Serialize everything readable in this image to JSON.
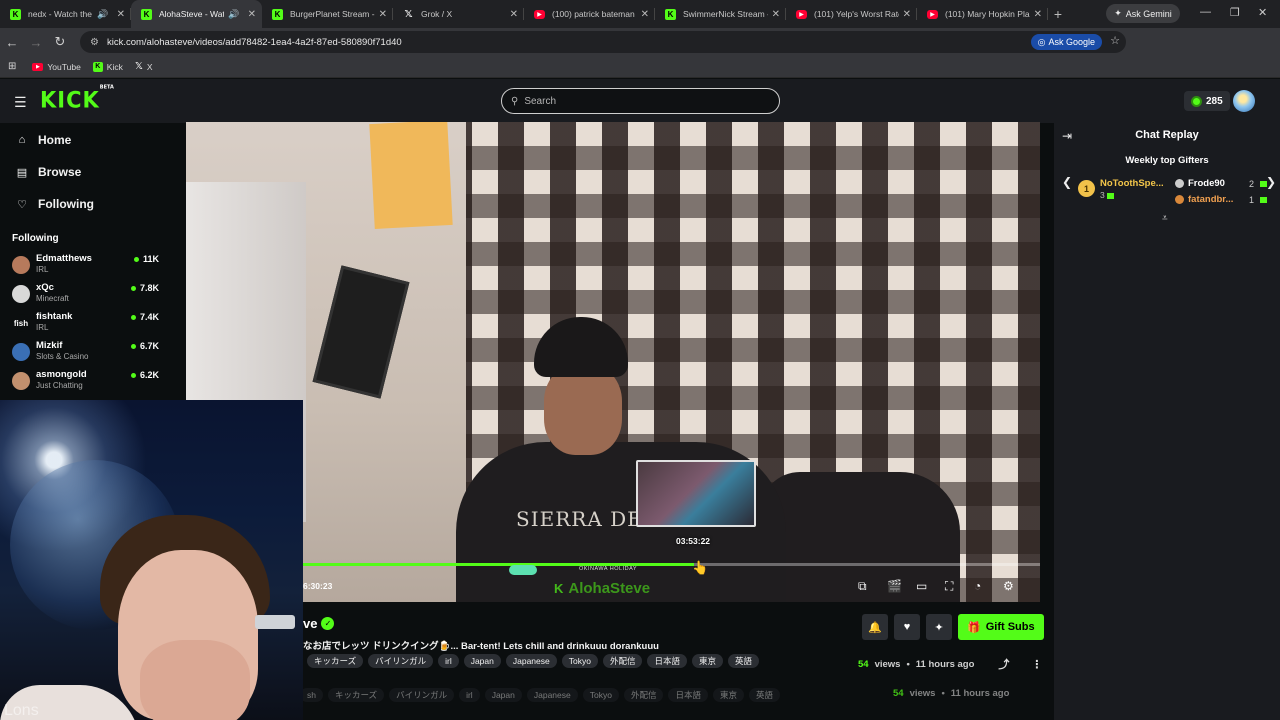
{
  "browser": {
    "tabs": [
      {
        "favicon": "kick",
        "title": "nedx - Watch the V",
        "audio": true
      },
      {
        "favicon": "kick",
        "title": "AlohaSteve - Watch",
        "audio": true,
        "active": true
      },
      {
        "favicon": "kick",
        "title": "BurgerPlanet Stream -"
      },
      {
        "favicon": "x",
        "title": "Grok / X"
      },
      {
        "favicon": "youtube",
        "title": "(100) patrick bateman"
      },
      {
        "favicon": "kick",
        "title": "SwimmerNick Stream -"
      },
      {
        "favicon": "youtube",
        "title": "(101) Yelp's Worst Rate"
      },
      {
        "favicon": "youtube",
        "title": "(101) Mary Hopkin Pla"
      }
    ],
    "ask_gemini": "Ask Gemini",
    "url": "kick.com/alohasteve/videos/add78482-1ea4-4a2f-87ed-580890f71d40",
    "ask_google": "Ask Google",
    "bookmarks": [
      {
        "favicon": "youtube",
        "label": "YouTube"
      },
      {
        "favicon": "kick",
        "label": "Kick"
      },
      {
        "favicon": "x",
        "label": "X"
      }
    ]
  },
  "header": {
    "logo": "KICK",
    "logo_badge": "BETA",
    "search_placeholder": "Search",
    "points": "285"
  },
  "sidebar": {
    "nav": [
      {
        "icon": "home-icon",
        "label": "Home"
      },
      {
        "icon": "browse-icon",
        "label": "Browse"
      },
      {
        "icon": "heart-icon",
        "label": "Following"
      }
    ],
    "following_title": "Following",
    "following": [
      {
        "name": "Edmatthews",
        "category": "IRL",
        "viewers": "11K",
        "color": "#b77a5c"
      },
      {
        "name": "xQc",
        "category": "Minecraft",
        "viewers": "7.8K",
        "color": "#d8d8d8"
      },
      {
        "name": "fishtank",
        "category": "IRL",
        "viewers": "7.4K",
        "color": "#ffffff"
      },
      {
        "name": "Mizkif",
        "category": "Slots & Casino",
        "viewers": "6.7K",
        "color": "#3a6fb5"
      },
      {
        "name": "asmongold",
        "category": "Just Chatting",
        "viewers": "6.2K",
        "color": "#c2906e"
      }
    ]
  },
  "player": {
    "seek_preview_time": "03:53:22",
    "current_time": "6:30:23",
    "chapter_label": "OKINAWA HOLIDAY",
    "watermark": "AlohaSteve",
    "progress": 0.53,
    "shirt_text": "SIERRA DESIGNS"
  },
  "chat": {
    "title": "Chat Replay",
    "gifters_title": "Weekly top Gifters",
    "top_gifter": {
      "rank": "1",
      "name": "NoToothSpe...",
      "count": "3"
    },
    "gifters": [
      {
        "name": "Frode90",
        "count": "2",
        "color": "#ffffff",
        "dot": "#cccccc"
      },
      {
        "name": "fatandbr...",
        "count": "1",
        "color": "#f0a050",
        "dot": "#d9883a"
      }
    ]
  },
  "video_info": {
    "channel": "ve",
    "title": "なお店でレッツ ドリンクイング🍺... Bar-tent! Lets chill and drinkuuu dorankuuu",
    "tags": [
      "キッカーズ",
      "バイリンガル",
      "irl",
      "Japan",
      "Japanese",
      "Tokyo",
      "外配信",
      "日本語",
      "東京",
      "英語"
    ],
    "gift_subs": "Gift Subs",
    "views": "54",
    "views_label": "views",
    "ago": "11 hours ago",
    "ghost_tags": [
      "sh",
      "キッカーズ",
      "バイリンガル",
      "irl",
      "Japan",
      "Japanese",
      "Tokyo",
      "外配信",
      "日本語",
      "東京",
      "英語"
    ],
    "ghost_views": "54",
    "ghost_views_label": "views",
    "ghost_ago": "11 hours ago"
  },
  "webcam": {
    "overlay_text": "Lons"
  }
}
